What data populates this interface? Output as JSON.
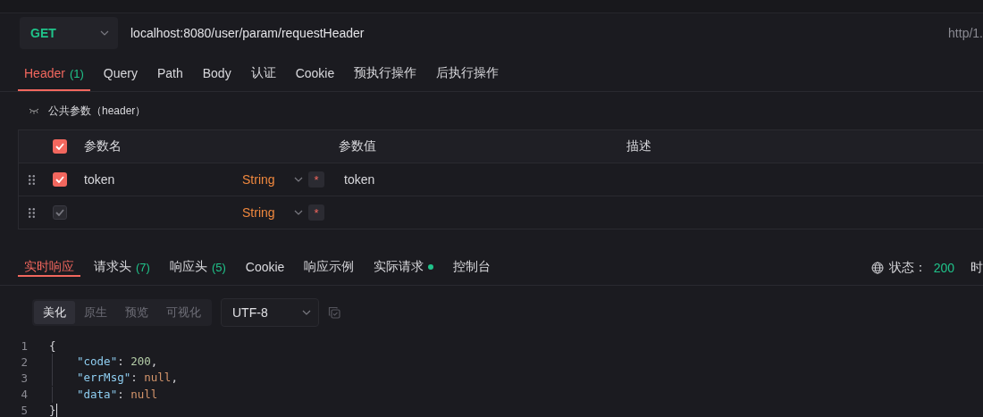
{
  "request": {
    "method": "GET",
    "url": "localhost:8080/user/param/requestHeader",
    "protocol": "http/1."
  },
  "request_tabs": [
    {
      "label": "Header",
      "count": "(1)",
      "selected": true
    },
    {
      "label": "Query",
      "selected": false
    },
    {
      "label": "Path",
      "selected": false
    },
    {
      "label": "Body",
      "selected": false
    },
    {
      "label": "认证",
      "selected": false
    },
    {
      "label": "Cookie",
      "selected": false
    },
    {
      "label": "预执行操作",
      "selected": false
    },
    {
      "label": "后执行操作",
      "selected": false
    }
  ],
  "section": {
    "title": "公共参数（header）",
    "expanded": false
  },
  "params_table": {
    "columns": [
      "参数名",
      "参数值",
      "描述"
    ],
    "all_checked": true,
    "rows": [
      {
        "name": "token",
        "type": "String",
        "required": "*",
        "value": "token",
        "checked": true,
        "disabled": false
      },
      {
        "type": "String",
        "required": "*",
        "checked": true,
        "disabled": true
      }
    ]
  },
  "response_tabs": [
    {
      "label": "实时响应",
      "selected": true
    },
    {
      "label": "请求头",
      "count": "(7)",
      "selected": false
    },
    {
      "label": "响应头",
      "count": "(5)",
      "selected": false
    },
    {
      "label": "Cookie",
      "selected": false
    },
    {
      "label": "响应示例",
      "selected": false
    },
    {
      "label": "实际请求",
      "dot": true,
      "selected": false
    },
    {
      "label": "控制台",
      "selected": false
    }
  ],
  "status": {
    "label": "状态：",
    "code": "200",
    "cut_label": "时"
  },
  "view_modes": [
    {
      "label": "美化",
      "selected": true
    },
    {
      "label": "原生",
      "selected": false
    },
    {
      "label": "预览",
      "selected": false
    },
    {
      "label": "可视化",
      "selected": false
    }
  ],
  "encoding": "UTF-8",
  "code_lines": [
    {
      "number": "1",
      "indent": false,
      "tokens": [
        {
          "kind": "punct",
          "text": "{"
        }
      ]
    },
    {
      "number": "2",
      "indent": true,
      "tokens": [
        {
          "kind": "key",
          "text": "\"code\""
        },
        {
          "kind": "punct",
          "text": ": "
        },
        {
          "kind": "number",
          "text": "200"
        },
        {
          "kind": "punct",
          "text": ","
        }
      ]
    },
    {
      "number": "3",
      "indent": true,
      "tokens": [
        {
          "kind": "key",
          "text": "\"errMsg\""
        },
        {
          "kind": "punct",
          "text": ": "
        },
        {
          "kind": "null",
          "text": "null"
        },
        {
          "kind": "punct",
          "text": ","
        }
      ]
    },
    {
      "number": "4",
      "indent": true,
      "tokens": [
        {
          "kind": "key",
          "text": "\"data\""
        },
        {
          "kind": "punct",
          "text": ": "
        },
        {
          "kind": "null",
          "text": "null"
        }
      ]
    },
    {
      "number": "5",
      "indent": false,
      "tokens": [
        {
          "kind": "punct",
          "text": "}"
        }
      ]
    }
  ]
}
